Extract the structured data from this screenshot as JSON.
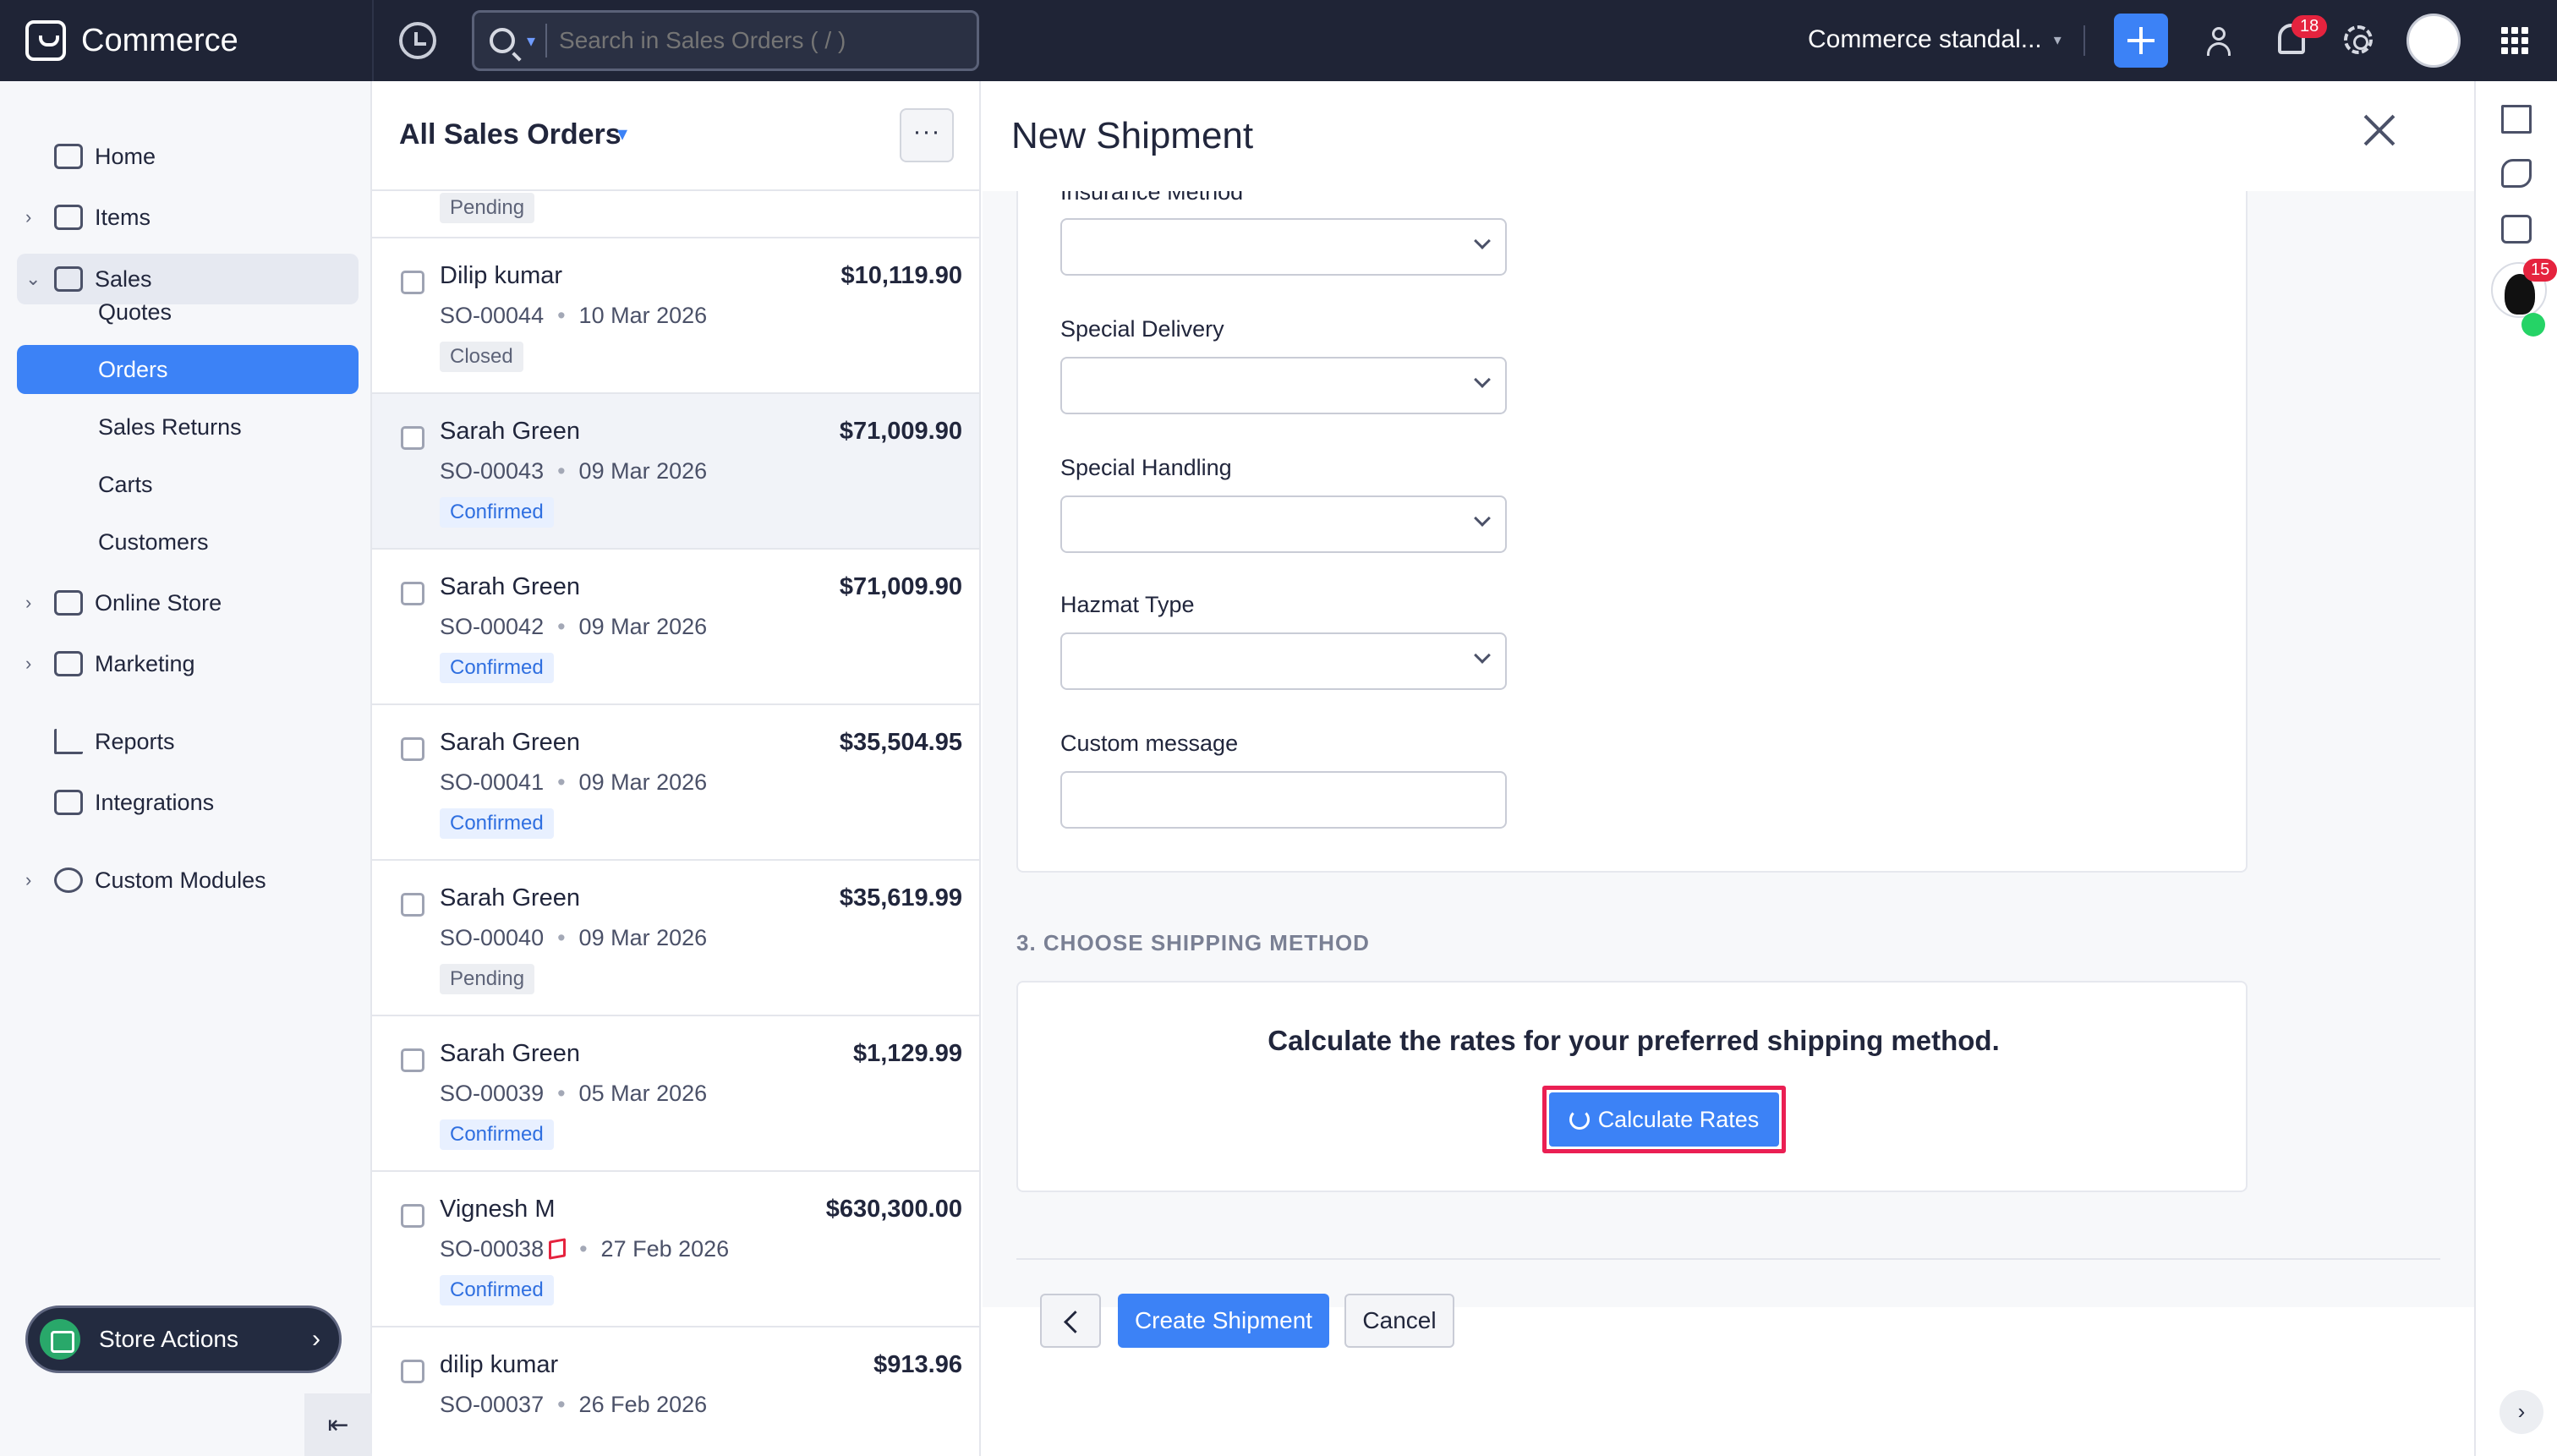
{
  "topbar": {
    "app_name": "Commerce",
    "search_placeholder": "Search in Sales Orders ( / )",
    "org_name": "Commerce standal...",
    "notification_count": "18"
  },
  "sidebar": {
    "items": [
      {
        "label": "Home",
        "icon": "home-icon"
      },
      {
        "label": "Items",
        "icon": "items-icon"
      },
      {
        "label": "Sales",
        "icon": "cart-icon"
      },
      {
        "label": "Quotes"
      },
      {
        "label": "Orders"
      },
      {
        "label": "Sales Returns"
      },
      {
        "label": "Carts"
      },
      {
        "label": "Customers"
      },
      {
        "label": "Online Store",
        "icon": "store-icon"
      },
      {
        "label": "Marketing",
        "icon": "megaphone-icon"
      },
      {
        "label": "Reports",
        "icon": "bar-chart-icon"
      },
      {
        "label": "Integrations",
        "icon": "plug-icon"
      },
      {
        "label": "Custom Modules",
        "icon": "modules-icon"
      }
    ],
    "store_actions_label": "Store Actions"
  },
  "orders_list": {
    "title": "All Sales Orders",
    "top_partial_status": "Pending",
    "rows": [
      {
        "name": "Dilip kumar",
        "amount": "$10,119.90",
        "number": "SO-00044",
        "date": "10 Mar 2026",
        "status": "Closed"
      },
      {
        "name": "Sarah Green",
        "amount": "$71,009.90",
        "number": "SO-00043",
        "date": "09 Mar 2026",
        "status": "Confirmed"
      },
      {
        "name": "Sarah Green",
        "amount": "$71,009.90",
        "number": "SO-00042",
        "date": "09 Mar 2026",
        "status": "Confirmed"
      },
      {
        "name": "Sarah Green",
        "amount": "$35,504.95",
        "number": "SO-00041",
        "date": "09 Mar 2026",
        "status": "Confirmed"
      },
      {
        "name": "Sarah Green",
        "amount": "$35,619.99",
        "number": "SO-00040",
        "date": "09 Mar 2026",
        "status": "Pending"
      },
      {
        "name": "Sarah Green",
        "amount": "$1,129.99",
        "number": "SO-00039",
        "date": "05 Mar 2026",
        "status": "Confirmed"
      },
      {
        "name": "Vignesh M",
        "amount": "$630,300.00",
        "number": "SO-00038",
        "date": "27 Feb 2026",
        "status": "Confirmed"
      },
      {
        "name": "dilip kumar",
        "amount": "$913.96",
        "number": "SO-00037",
        "date": "26 Feb 2026",
        "status": ""
      }
    ]
  },
  "shipment": {
    "title": "New Shipment",
    "fields": [
      {
        "label": "Insurance Method",
        "value": ""
      },
      {
        "label": "Special Delivery",
        "value": ""
      },
      {
        "label": "Special Handling",
        "value": ""
      },
      {
        "label": "Hazmat Type",
        "value": ""
      },
      {
        "label": "Custom message",
        "value": ""
      }
    ],
    "section_heading": "3. CHOOSE SHIPPING METHOD",
    "rates_message": "Calculate the rates for your preferred shipping method.",
    "calculate_label": "Calculate Rates",
    "create_label": "Create Shipment",
    "cancel_label": "Cancel"
  },
  "rail": {
    "chat_badge": "15"
  },
  "colors": {
    "topbar_bg": "#1f2436",
    "accent": "#3c82f6",
    "highlight": "#ea1f53",
    "badge": "#e5233e"
  }
}
